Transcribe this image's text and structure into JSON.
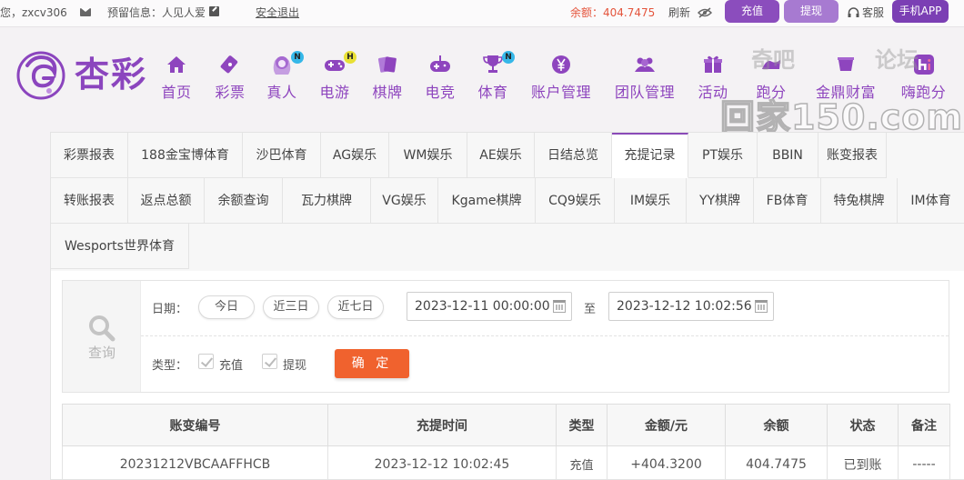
{
  "topbar": {
    "greeting": "您，zxcv306",
    "reserved_label": "预留信息：人见人爱",
    "logout": "安全退出",
    "balance": "余额：404.7475",
    "refresh": "刷新",
    "deposit_btn": "充值",
    "withdraw_btn": "提现",
    "service": "客服",
    "app_btn": "手机APP",
    "colors": {
      "balance": "#e4543c",
      "deposit": "#8b4dbd",
      "withdraw": "#a77ad1",
      "app": "#7b3fb4"
    }
  },
  "brand": {
    "name": "杏彩",
    "color": "#8b45be"
  },
  "nav": [
    {
      "label": "首页",
      "icon": "home-icon"
    },
    {
      "label": "彩票",
      "icon": "lottery-ticket-icon"
    },
    {
      "label": "真人",
      "icon": "live-dealer-icon",
      "badge": "N"
    },
    {
      "label": "电游",
      "icon": "gamepad-icon",
      "badge": "H"
    },
    {
      "label": "棋牌",
      "icon": "cards-icon"
    },
    {
      "label": "电竞",
      "icon": "esports-controller-icon"
    },
    {
      "label": "体育",
      "icon": "trophy-icon",
      "badge": "N"
    },
    {
      "label": "账户管理",
      "icon": "yen-coin-icon"
    },
    {
      "label": "团队管理",
      "icon": "team-icon"
    },
    {
      "label": "活动",
      "icon": "gift-icon"
    },
    {
      "label": "跑分",
      "icon": "running-score-icon"
    },
    {
      "label": "金鼎财富",
      "icon": "wealth-icon"
    },
    {
      "label": "嗨跑分",
      "icon": "app-hi-icon"
    }
  ],
  "watermark": {
    "line1": "奇吧",
    "line2": "论坛",
    "main": "回家150.com"
  },
  "tabs": [
    "彩票报表",
    "188金宝博体育",
    "沙巴体育",
    "AG娱乐",
    "WM娱乐",
    "AE娱乐",
    "日结总览",
    "充提记录",
    "PT娱乐",
    "BBIN",
    "账变报表",
    "转账报表",
    "返点总额",
    "余额查询",
    "瓦力棋牌",
    "VG娱乐",
    "Kgame棋牌",
    "CQ9娱乐",
    "IM娱乐",
    "YY棋牌",
    "FB体育",
    "特兔棋牌",
    "IM体育",
    "Wesports世界体育"
  ],
  "active_tab": "充提记录",
  "search": {
    "side_label": "查询",
    "date_label": "日期：",
    "quick": [
      "今日",
      "近三日",
      "近七日"
    ],
    "start": "2023-12-11 00:00:00",
    "to": "至",
    "end": "2023-12-12 10:02:56",
    "type_label": "类型：",
    "types": [
      "充值",
      "提现"
    ],
    "confirm": "确 定"
  },
  "table": {
    "headers": [
      "账变编号",
      "充提时间",
      "类型",
      "金额/元",
      "余额",
      "状态",
      "备注"
    ],
    "rows": [
      [
        "20231212VBCAAFFHCB",
        "2023-12-12 10:02:45",
        "充值",
        "+404.3200",
        "404.7475",
        "已到账",
        "-----"
      ]
    ]
  }
}
